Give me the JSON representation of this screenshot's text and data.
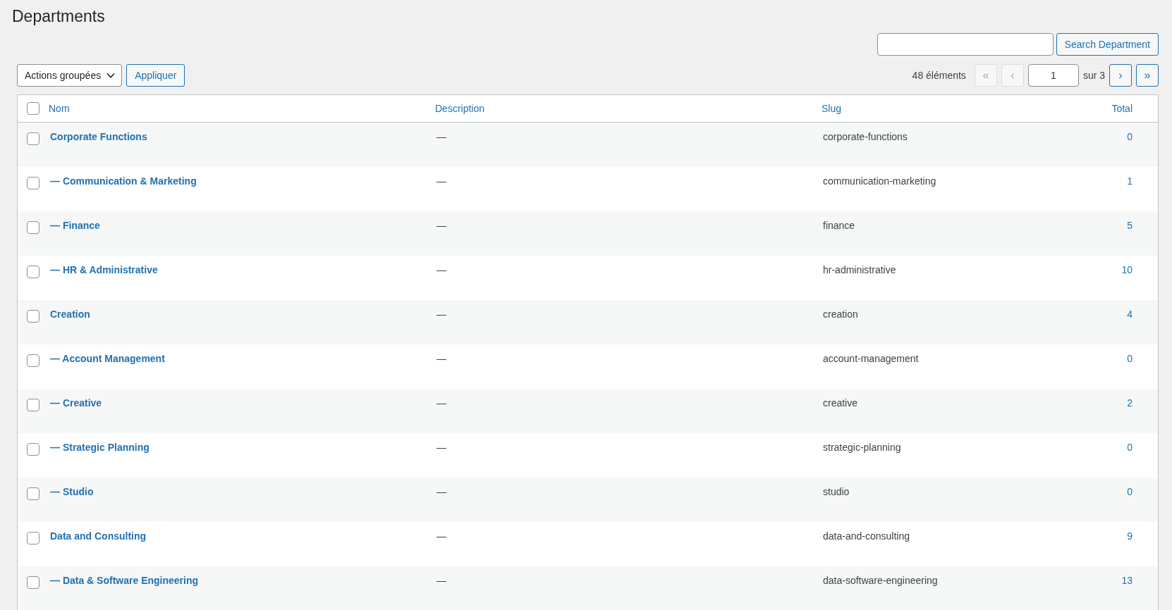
{
  "page_title": "Departments",
  "search": {
    "button": "Search Department"
  },
  "bulk_actions": {
    "label": "Actions groupées",
    "apply": "Appliquer"
  },
  "pagination": {
    "count": "48 éléments",
    "current_page": "1",
    "total_label": "sur 3",
    "buttons": [
      {
        "label": "«",
        "disabled": true
      },
      {
        "label": "‹",
        "disabled": true
      },
      {
        "label": "›",
        "disabled": false
      },
      {
        "label": "»",
        "disabled": false
      }
    ]
  },
  "table": {
    "select_all_checked": false,
    "columns": [
      "Nom",
      "Description",
      "Slug",
      "Total"
    ],
    "rows": [
      {
        "name": "Corporate Functions",
        "description": "—",
        "slug": "corporate-functions",
        "total": "0",
        "checked": false,
        "children": [
          {
            "name": "— Communication & Marketing",
            "description": "—",
            "slug": "communication-marketing",
            "total": "1",
            "checked": false
          },
          {
            "name": "— Finance",
            "description": "—",
            "slug": "finance",
            "total": "5",
            "checked": false
          },
          {
            "name": "— HR & Administrative",
            "description": "—",
            "slug": "hr-administrative",
            "total": "10",
            "checked": false
          }
        ]
      },
      {
        "name": "Creation",
        "description": "—",
        "slug": "creation",
        "total": "4",
        "checked": false,
        "children": [
          {
            "name": "— Account Management",
            "description": "—",
            "slug": "account-management",
            "total": "0",
            "checked": false
          },
          {
            "name": "— Creative",
            "description": "—",
            "slug": "creative",
            "total": "2",
            "checked": false
          },
          {
            "name": "— Strategic Planning",
            "description": "—",
            "slug": "strategic-planning",
            "total": "0",
            "checked": false
          },
          {
            "name": "— Studio",
            "description": "—",
            "slug": "studio",
            "total": "0",
            "checked": false
          }
        ]
      },
      {
        "name": "Data and Consulting",
        "description": "—",
        "slug": "data-and-consulting",
        "total": "9",
        "checked": false,
        "children": [
          {
            "name": "— Data & Software Engineering",
            "description": "—",
            "slug": "data-software-engineering",
            "total": "13",
            "checked": false
          }
        ]
      }
    ]
  }
}
